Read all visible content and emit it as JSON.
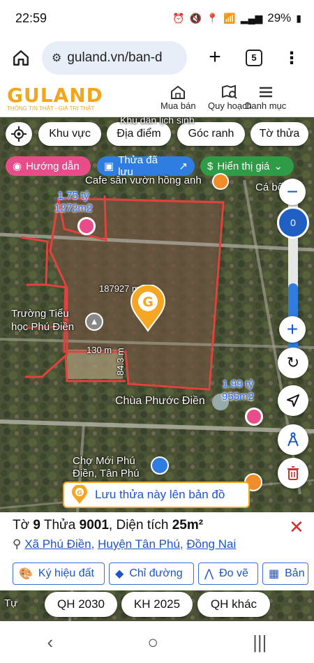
{
  "status": {
    "time": "22:59",
    "battery": "29%"
  },
  "browser": {
    "url": "guland.vn/ban-d",
    "tab_count": "5"
  },
  "site": {
    "logo": "GULAND",
    "tagline": "THÔNG TIN THẬT - GIÁ TRỊ THẬT",
    "nav": [
      {
        "label": "Mua bán",
        "icon": "house-icon"
      },
      {
        "label": "Quy hoạch",
        "icon": "map-search-icon"
      },
      {
        "label": "Danh mục",
        "icon": "hamburger-icon"
      }
    ]
  },
  "filters": [
    "Khu vực",
    "Địa điểm",
    "Góc ranh",
    "Tờ thửa"
  ],
  "pills": {
    "guide": "Hướng dẫn",
    "saved": "Thửa đã lưu",
    "price": "Hiển thị giá"
  },
  "map": {
    "labels": {
      "road_top": "Khu dân lịch sinh",
      "cafe": "Cafe sân vườn hồng anh",
      "ca_bon": "Cá bốn m",
      "school": "Trường Tiểu học Phú Điền",
      "area_big": "187927 m²",
      "width": "130 m",
      "height": "84.3 m",
      "pagoda": "Chùa Phước Điền",
      "market": "Chợ Mới Phú Điền, Tân Phú",
      "tu": "Tự"
    },
    "prices": [
      {
        "price": "1.75 tỷ",
        "area": "1272m2"
      },
      {
        "price": "1.99 tỷ",
        "area": "955m2"
      }
    ],
    "zoom_level": "0"
  },
  "save_bar": "Lưu thửa này lên bản đồ",
  "parcel": {
    "to_label": "Tờ",
    "to": "9",
    "thua_label": "Thửa",
    "thua": "9001",
    "area_label": "Diện tích",
    "area": "25m²",
    "commune": "Xã Phú Điền",
    "district": "Huyện Tân Phú",
    "province": "Đồng Nai"
  },
  "actions": [
    "Ký hiệu đất",
    "Chỉ đường",
    "Đo vẽ",
    "Bản"
  ],
  "plans": [
    "QH 2030",
    "KH 2025",
    "QH khác"
  ],
  "colors": {
    "brand": "#f2a61d",
    "blue": "#1e54c9",
    "pink": "#e84d8a",
    "parcel_outline": "#e2413e",
    "green": "#2e9b47"
  }
}
